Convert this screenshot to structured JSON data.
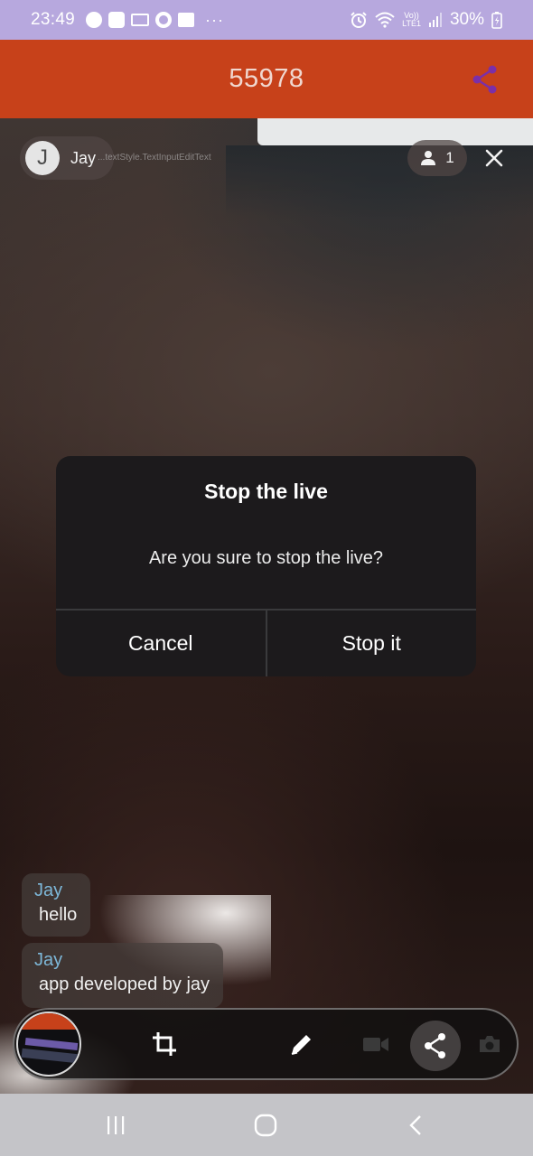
{
  "status_bar": {
    "time": "23:49",
    "battery_percent": "30%",
    "network_label_top": "Vo))",
    "network_label_bottom": "LTE1",
    "more": "···",
    "icons": [
      "spotify-icon",
      "s-app-icon",
      "gmail-icon",
      "circle-app-icon",
      "gallery-icon",
      "alarm-icon",
      "wifi-icon",
      "signal-icon",
      "battery-charging-icon"
    ]
  },
  "app_bar": {
    "title": "55978",
    "share_icon": "share-icon",
    "background": "#c7411a",
    "share_color": "#7b2fa8"
  },
  "stream": {
    "host": {
      "initial": "J",
      "name": "Jay"
    },
    "overlay_text": "...textStyle.TextInputEditText",
    "viewer_count": "1"
  },
  "dialog": {
    "title": "Stop the live",
    "message": "Are you sure to stop the live?",
    "cancel_label": "Cancel",
    "confirm_label": "Stop it"
  },
  "chat": [
    {
      "name": "Jay",
      "text": "hello"
    },
    {
      "name": "Jay",
      "text": "app developed by jay"
    }
  ],
  "toolbar": {
    "icons": [
      "screen-thumbnail",
      "crop-icon",
      "pen-icon",
      "video-camera-icon",
      "share-icon",
      "camera-icon"
    ]
  },
  "nav_bar": {
    "buttons": [
      "recent-apps-icon",
      "home-icon",
      "back-icon"
    ]
  }
}
